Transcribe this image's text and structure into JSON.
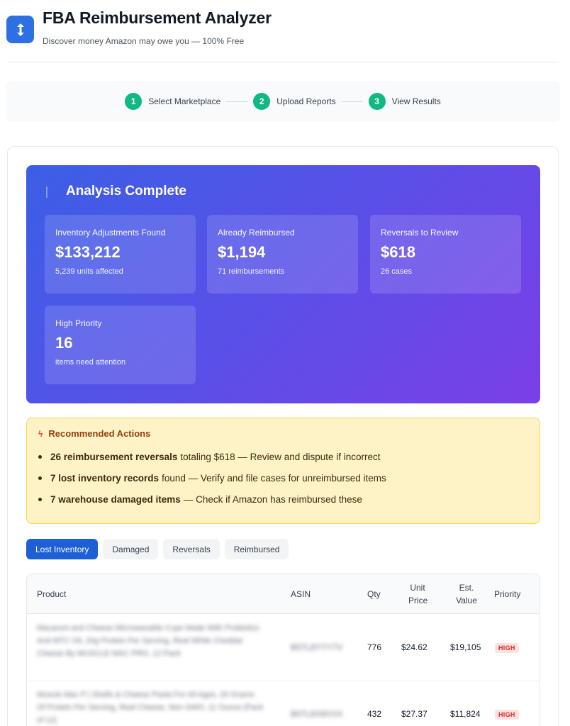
{
  "header": {
    "title": "FBA Reimbursement Analyzer",
    "subtitle": "Discover money Amazon may owe you — 100% Free",
    "logo_icon": "up-down-arrows-icon",
    "accent": "#2f6fe4"
  },
  "stepper": {
    "steps": [
      {
        "num": "1",
        "label": "Select Marketplace"
      },
      {
        "num": "2",
        "label": "Upload Reports"
      },
      {
        "num": "3",
        "label": "View Results"
      }
    ],
    "color": "#10b981"
  },
  "analysis": {
    "title": "Analysis Complete",
    "stats": [
      {
        "label": "Inventory Adjustments Found",
        "value": "$133,212",
        "sub": "5,239 units affected"
      },
      {
        "label": "Already Reimbursed",
        "value": "$1,194",
        "sub": "71 reimbursements"
      },
      {
        "label": "Reversals to Review",
        "value": "$618",
        "sub": "26 cases"
      },
      {
        "label": "High Priority",
        "value": "16",
        "sub": "items need attention"
      }
    ]
  },
  "actions": {
    "title": "Recommended Actions",
    "icon": "lightning-icon",
    "items": [
      {
        "bold": "26 reimbursement reversals",
        "text": "totaling $618 — Review and dispute if incorrect"
      },
      {
        "bold": "7 lost inventory records",
        "text": "found — Verify and file cases for unreimbursed items"
      },
      {
        "bold": "7 warehouse damaged items",
        "text": "— Check if Amazon has reimbursed these"
      }
    ]
  },
  "tabs": [
    {
      "label": "Lost Inventory",
      "active": true
    },
    {
      "label": "Damaged",
      "active": false
    },
    {
      "label": "Reversals",
      "active": false
    },
    {
      "label": "Reimbursed",
      "active": false
    }
  ],
  "table": {
    "headers": {
      "product": "Product",
      "asin": "ASIN",
      "qty": "Qty",
      "unit_price_1": "Unit",
      "unit_price_2": "Price",
      "est_value_1": "Est.",
      "est_value_2": "Value",
      "priority": "Priority"
    },
    "rows": [
      {
        "product": "Macaroni and Cheese Microwavable Cups Made With Probiotics And MTC Oil, 20g Protein Per Serving, Real White Cheddar Cheese By MUSCLE MAC PRO, 12 Pack",
        "product_extra": "(Unreadable)",
        "asin": "B07L8YYY7V",
        "qty": "776",
        "unit_price": "$24.62",
        "est_value": "$19,105",
        "priority": "HIGH"
      },
      {
        "product": "Muscle Mac P | Shells & Cheese Pasta For All Ages, 20 Grams Of Protein Per Serving, Real Cheese, Non GMO, 11 Ounce (Pack of 12)",
        "asin": "B07L8X8XXX",
        "qty": "432",
        "unit_price": "$27.37",
        "est_value": "$11,824",
        "priority": "HIGH"
      }
    ]
  }
}
